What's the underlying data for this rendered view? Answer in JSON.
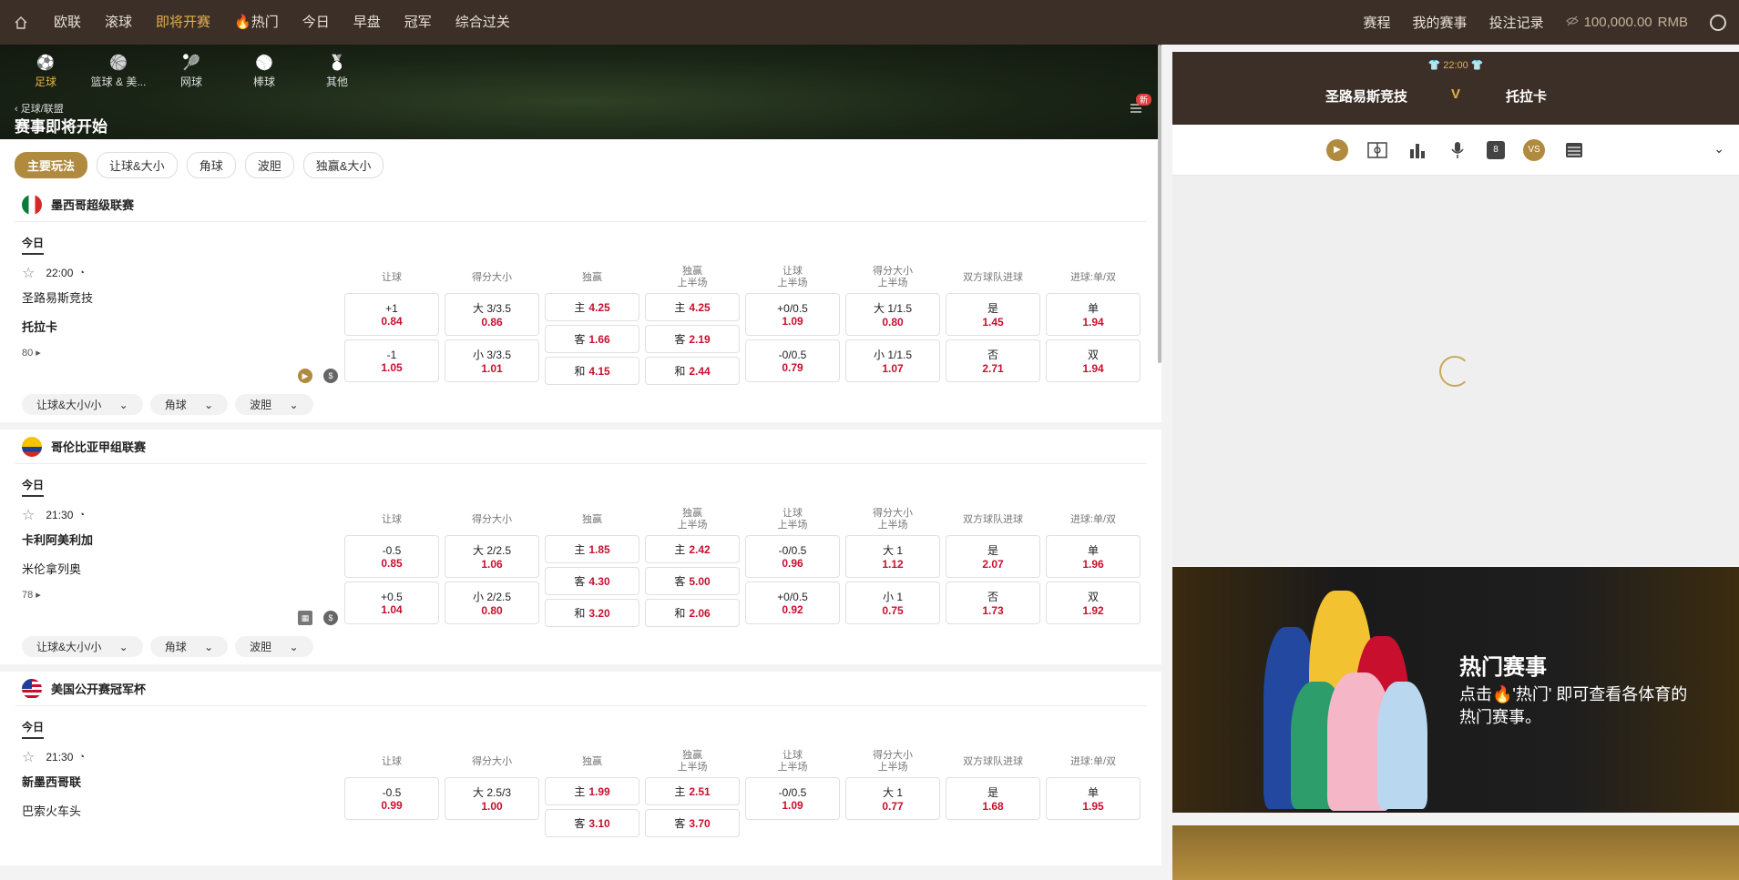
{
  "nav": {
    "items": [
      "欧联",
      "滚球",
      "即将开赛",
      "热门",
      "今日",
      "早盘",
      "冠军",
      "综合过关"
    ],
    "active_index": 2,
    "right": [
      "赛程",
      "我的赛事",
      "投注记录"
    ],
    "balance": "100,000.00",
    "currency": "RMB"
  },
  "sports": [
    {
      "label": "足球",
      "icon": "soccer-icon"
    },
    {
      "label": "篮球 & 美...",
      "icon": "basketball-icon"
    },
    {
      "label": "网球",
      "icon": "tennis-icon"
    },
    {
      "label": "棒球",
      "icon": "baseball-icon"
    },
    {
      "label": "其他",
      "icon": "medal-icon"
    }
  ],
  "header": {
    "crumb": "足球/联盟",
    "title": "赛事即将开始",
    "badge": "新"
  },
  "tabs": [
    "主要玩法",
    "让球&大小",
    "角球",
    "波胆",
    "独赢&大小"
  ],
  "market_headers": [
    "让球",
    "得分大小",
    "独赢",
    "独赢\n上半场",
    "让球\n上半场",
    "得分大小\n上半场",
    "双方球队进球",
    "进球:单/双"
  ],
  "dropdowns": [
    "让球&大小/小",
    "角球",
    "波胆"
  ],
  "leagues": [
    {
      "name": "墨西哥超级联赛",
      "day": "今日",
      "match": {
        "time": "22:00",
        "home": "圣路易斯竞技",
        "away": "托拉卡",
        "fav": 1,
        "more": "80",
        "hcap": [
          [
            "+1",
            "0.84"
          ],
          [
            "-1",
            "1.05"
          ]
        ],
        "ou": [
          [
            "大 3/3.5",
            "0.86"
          ],
          [
            "小 3/3.5",
            "1.01"
          ]
        ],
        "x12": [
          [
            "主",
            "4.25"
          ],
          [
            "客",
            "1.66"
          ],
          [
            "和",
            "4.15"
          ]
        ],
        "x12h": [
          [
            "主",
            "4.25"
          ],
          [
            "客",
            "2.19"
          ],
          [
            "和",
            "2.44"
          ]
        ],
        "hcaph": [
          [
            "+0/0.5",
            "1.09"
          ],
          [
            "-0/0.5",
            "0.79"
          ]
        ],
        "ouh": [
          [
            "大 1/1.5",
            "0.80"
          ],
          [
            "小 1/1.5",
            "1.07"
          ]
        ],
        "btts": [
          [
            "是",
            "1.45"
          ],
          [
            "否",
            "2.71"
          ]
        ],
        "oe": [
          [
            "单",
            "1.94"
          ],
          [
            "双",
            "1.94"
          ]
        ]
      }
    },
    {
      "name": "哥伦比亚甲组联赛",
      "day": "今日",
      "match": {
        "time": "21:30",
        "home": "卡利阿美利加",
        "away": "米伦拿列奥",
        "fav": 0,
        "more": "78",
        "hcap": [
          [
            "-0.5",
            "0.85"
          ],
          [
            "+0.5",
            "1.04"
          ]
        ],
        "ou": [
          [
            "大 2/2.5",
            "1.06"
          ],
          [
            "小 2/2.5",
            "0.80"
          ]
        ],
        "x12": [
          [
            "主",
            "1.85"
          ],
          [
            "客",
            "4.30"
          ],
          [
            "和",
            "3.20"
          ]
        ],
        "x12h": [
          [
            "主",
            "2.42"
          ],
          [
            "客",
            "5.00"
          ],
          [
            "和",
            "2.06"
          ]
        ],
        "hcaph": [
          [
            "-0/0.5",
            "0.96"
          ],
          [
            "+0/0.5",
            "0.92"
          ]
        ],
        "ouh": [
          [
            "大 1",
            "1.12"
          ],
          [
            "小 1",
            "0.75"
          ]
        ],
        "btts": [
          [
            "是",
            "2.07"
          ],
          [
            "否",
            "1.73"
          ]
        ],
        "oe": [
          [
            "单",
            "1.96"
          ],
          [
            "双",
            "1.92"
          ]
        ]
      }
    },
    {
      "name": "美国公开赛冠军杯",
      "day": "今日",
      "match": {
        "time": "21:30",
        "home": "新墨西哥联",
        "away": "巴索火车头",
        "fav": 0,
        "more": "",
        "hcap": [
          [
            "-0.5",
            "0.99"
          ],
          [
            "",
            ""
          ]
        ],
        "ou": [
          [
            "大 2.5/3",
            "1.00"
          ],
          [
            "",
            ""
          ]
        ],
        "x12": [
          [
            "主",
            "1.99"
          ],
          [
            "客",
            "3.10"
          ],
          [
            "",
            ""
          ]
        ],
        "x12h": [
          [
            "主",
            "2.51"
          ],
          [
            "客",
            "3.70"
          ],
          [
            "",
            ""
          ]
        ],
        "hcaph": [
          [
            "-0/0.5",
            "1.09"
          ],
          [
            "",
            ""
          ]
        ],
        "ouh": [
          [
            "大 1",
            "0.77"
          ],
          [
            "",
            ""
          ]
        ],
        "btts": [
          [
            "是",
            "1.68"
          ],
          [
            "",
            ""
          ]
        ],
        "oe": [
          [
            "单",
            "1.95"
          ],
          [
            "",
            ""
          ]
        ]
      }
    }
  ],
  "right": {
    "time": "22:00",
    "home": "圣路易斯竞技",
    "vs": "V",
    "away": "托拉卡",
    "tools": [
      "play-icon",
      "field-icon",
      "stats-icon",
      "mic-icon",
      "jersey-icon",
      "vs-icon",
      "scoreboard-icon"
    ],
    "vs_label": "VS",
    "jersey_number": "8",
    "promo_title": "热门赛事",
    "promo_text": "点击🔥'热门' 即可查看各体育的热门赛事。"
  },
  "colors": {
    "accent": "#b08a3e",
    "odds": "#c8102e",
    "topbar": "#3b2f28"
  }
}
